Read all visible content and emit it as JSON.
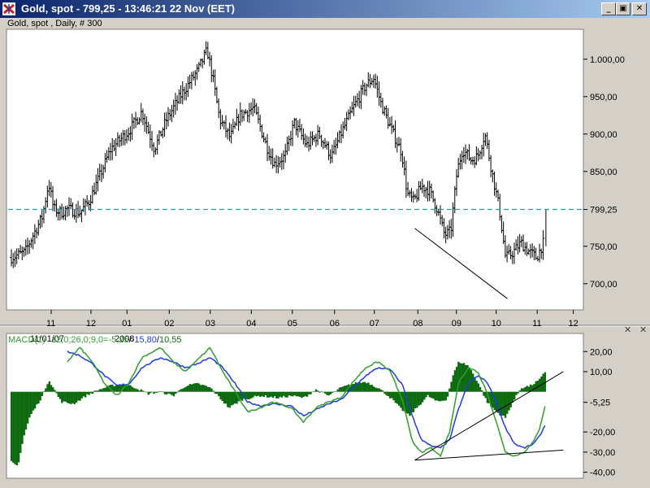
{
  "window": {
    "title": "Gold, spot - 799,25 - 13:46:21  22 Nov (EET)",
    "minimize_glyph": "_",
    "maximize_glyph": "▣",
    "close_glyph": "✕"
  },
  "colors": {
    "title_bar": "#0a246a",
    "price_bars": "#000000",
    "last_price_line": "#2f9fa0",
    "macd_line": "#2ea02e",
    "signal_line": "#1e3cdc",
    "histogram": "#0e6a0e"
  },
  "chart_data": [
    {
      "type": "ohlc",
      "title": "Gold, spot , Daily, # 300",
      "x_tick_labels": [
        "11",
        "12",
        "01",
        "02",
        "03",
        "04",
        "05",
        "06",
        "07",
        "08",
        "09",
        "10",
        "11",
        "12"
      ],
      "x_sub_labels": [
        "11/01/07",
        "2008"
      ],
      "y_tick_labels": [
        "1.000,00",
        "950,00",
        "900,00",
        "850,00",
        "799,25",
        "750,00",
        "700,00"
      ],
      "y_tick_values": [
        1000,
        950,
        900,
        850,
        799.25,
        750,
        700
      ],
      "ylim": [
        665,
        1040
      ],
      "last_price": 799.25,
      "last_price_label": "799,25",
      "grid": false,
      "price_path": [
        {
          "t": 0,
          "v": 735
        },
        {
          "t": 2.2,
          "v": 742
        },
        {
          "t": 3.2,
          "v": 760
        },
        {
          "t": 5,
          "v": 790
        },
        {
          "t": 6,
          "v": 835
        },
        {
          "t": 6.8,
          "v": 800
        },
        {
          "t": 8,
          "v": 795
        },
        {
          "t": 9,
          "v": 800
        },
        {
          "t": 11,
          "v": 795
        },
        {
          "t": 12.5,
          "v": 810
        },
        {
          "t": 14,
          "v": 840
        },
        {
          "t": 16,
          "v": 880
        },
        {
          "t": 19,
          "v": 905
        },
        {
          "t": 21,
          "v": 930
        },
        {
          "t": 23,
          "v": 880
        },
        {
          "t": 25,
          "v": 920
        },
        {
          "t": 27.5,
          "v": 955
        },
        {
          "t": 30,
          "v": 985
        },
        {
          "t": 31.5,
          "v": 1012
        },
        {
          "t": 32.4,
          "v": 975
        },
        {
          "t": 33.5,
          "v": 920
        },
        {
          "t": 35.2,
          "v": 895
        },
        {
          "t": 36.7,
          "v": 925
        },
        {
          "t": 39,
          "v": 935
        },
        {
          "t": 41,
          "v": 885
        },
        {
          "t": 42.3,
          "v": 860
        },
        {
          "t": 44,
          "v": 870
        },
        {
          "t": 45.5,
          "v": 915
        },
        {
          "t": 47.5,
          "v": 885
        },
        {
          "t": 49.5,
          "v": 900
        },
        {
          "t": 51.5,
          "v": 870
        },
        {
          "t": 53,
          "v": 900
        },
        {
          "t": 55,
          "v": 935
        },
        {
          "t": 57,
          "v": 965
        },
        {
          "t": 58.3,
          "v": 975
        },
        {
          "t": 59.5,
          "v": 940
        },
        {
          "t": 61.2,
          "v": 905
        },
        {
          "t": 62.8,
          "v": 875
        },
        {
          "t": 63.7,
          "v": 820
        },
        {
          "t": 64.7,
          "v": 810
        },
        {
          "t": 66,
          "v": 830
        },
        {
          "t": 67.2,
          "v": 825
        },
        {
          "t": 68.5,
          "v": 800
        },
        {
          "t": 69.7,
          "v": 765
        },
        {
          "t": 70.7,
          "v": 770
        },
        {
          "t": 71.7,
          "v": 850
        },
        {
          "t": 72.6,
          "v": 880
        },
        {
          "t": 74,
          "v": 865
        },
        {
          "t": 75,
          "v": 870
        },
        {
          "t": 76.2,
          "v": 900
        },
        {
          "t": 77.3,
          "v": 850
        },
        {
          "t": 78.5,
          "v": 800
        },
        {
          "t": 79.5,
          "v": 735
        },
        {
          "t": 80.5,
          "v": 740
        },
        {
          "t": 82,
          "v": 755
        },
        {
          "t": 83,
          "v": 745
        },
        {
          "t": 84.5,
          "v": 735
        },
        {
          "t": 85.6,
          "v": 755
        },
        {
          "t": 86,
          "v": 799.25
        }
      ],
      "trendlines": [
        {
          "from": {
            "t": 64.9,
            "v": 774
          },
          "to": {
            "t": 79.8,
            "v": 680
          }
        }
      ]
    },
    {
      "type": "macd",
      "title": "MACD(1) 12,0;26,0;9,0=-5,25/-15,80/10,55",
      "title_parts": {
        "name": "MACD(1)",
        "params": "12,0;26,0;9,0=",
        "macd_value": "-5,25",
        "signal_value": "-15,80",
        "hist_value": "10,55",
        "separator": "/"
      },
      "y_tick_labels": [
        "20,00",
        "10,00",
        "-5,25",
        "-20,00",
        "-30,00",
        "-40,00"
      ],
      "y_tick_values": [
        20,
        10,
        -5.25,
        -20,
        -30,
        -40
      ],
      "ylim": [
        -43,
        29
      ],
      "last_values": {
        "macd": -5.25,
        "signal": -15.8,
        "histogram": 10.55
      },
      "macd_path": [
        {
          "t": 9,
          "v": 15
        },
        {
          "t": 11,
          "v": 22
        },
        {
          "t": 13,
          "v": 15
        },
        {
          "t": 15,
          "v": 4
        },
        {
          "t": 17,
          "v": -2
        },
        {
          "t": 19,
          "v": 5
        },
        {
          "t": 21,
          "v": 17
        },
        {
          "t": 24,
          "v": 22
        },
        {
          "t": 26,
          "v": 15
        },
        {
          "t": 28,
          "v": 10
        },
        {
          "t": 30,
          "v": 16
        },
        {
          "t": 32,
          "v": 22
        },
        {
          "t": 34,
          "v": 10
        },
        {
          "t": 36,
          "v": 0
        },
        {
          "t": 38,
          "v": -10
        },
        {
          "t": 40,
          "v": -8
        },
        {
          "t": 42,
          "v": -5
        },
        {
          "t": 45,
          "v": -8
        },
        {
          "t": 47,
          "v": -15
        },
        {
          "t": 49,
          "v": -8
        },
        {
          "t": 51,
          "v": -5
        },
        {
          "t": 53,
          "v": -3
        },
        {
          "t": 55,
          "v": 5
        },
        {
          "t": 57,
          "v": 12
        },
        {
          "t": 59,
          "v": 15
        },
        {
          "t": 61,
          "v": 10
        },
        {
          "t": 63,
          "v": -5
        },
        {
          "t": 64.5,
          "v": -25
        },
        {
          "t": 66,
          "v": -30
        },
        {
          "t": 67.5,
          "v": -28
        },
        {
          "t": 69,
          "v": -32
        },
        {
          "t": 70.5,
          "v": -20
        },
        {
          "t": 72,
          "v": 5
        },
        {
          "t": 73.5,
          "v": 12
        },
        {
          "t": 75,
          "v": 10
        },
        {
          "t": 76.5,
          "v": 0
        },
        {
          "t": 78,
          "v": -15
        },
        {
          "t": 79.5,
          "v": -30
        },
        {
          "t": 81,
          "v": -32
        },
        {
          "t": 82.5,
          "v": -30
        },
        {
          "t": 84,
          "v": -25
        },
        {
          "t": 85,
          "v": -18
        },
        {
          "t": 86,
          "v": -5.25
        }
      ],
      "signal_path": [
        {
          "t": 9,
          "v": 20
        },
        {
          "t": 11,
          "v": 18
        },
        {
          "t": 13,
          "v": 14
        },
        {
          "t": 15,
          "v": 8
        },
        {
          "t": 17,
          "v": 3
        },
        {
          "t": 19,
          "v": 4
        },
        {
          "t": 21,
          "v": 12
        },
        {
          "t": 24,
          "v": 17
        },
        {
          "t": 26,
          "v": 15
        },
        {
          "t": 28,
          "v": 12
        },
        {
          "t": 30,
          "v": 14
        },
        {
          "t": 32,
          "v": 17
        },
        {
          "t": 34,
          "v": 12
        },
        {
          "t": 36,
          "v": 4
        },
        {
          "t": 38,
          "v": -5
        },
        {
          "t": 40,
          "v": -7
        },
        {
          "t": 42,
          "v": -6
        },
        {
          "t": 45,
          "v": -7
        },
        {
          "t": 47,
          "v": -12
        },
        {
          "t": 49,
          "v": -9
        },
        {
          "t": 51,
          "v": -6
        },
        {
          "t": 53,
          "v": -4
        },
        {
          "t": 55,
          "v": 2
        },
        {
          "t": 57,
          "v": 8
        },
        {
          "t": 59,
          "v": 12
        },
        {
          "t": 61,
          "v": 11
        },
        {
          "t": 63,
          "v": 3
        },
        {
          "t": 64.5,
          "v": -12
        },
        {
          "t": 66,
          "v": -24
        },
        {
          "t": 67.5,
          "v": -27
        },
        {
          "t": 69,
          "v": -28
        },
        {
          "t": 70.5,
          "v": -24
        },
        {
          "t": 72,
          "v": -8
        },
        {
          "t": 73.5,
          "v": 4
        },
        {
          "t": 75,
          "v": 8
        },
        {
          "t": 76.5,
          "v": 5
        },
        {
          "t": 78,
          "v": -5
        },
        {
          "t": 79.5,
          "v": -18
        },
        {
          "t": 81,
          "v": -26
        },
        {
          "t": 82.5,
          "v": -28
        },
        {
          "t": 84,
          "v": -26
        },
        {
          "t": 85,
          "v": -22
        },
        {
          "t": 86,
          "v": -15.8
        }
      ],
      "histogram_peaks": [
        {
          "t": 0,
          "v": -35
        },
        {
          "t": 1,
          "v": -37
        },
        {
          "t": 2,
          "v": -22
        },
        {
          "t": 3,
          "v": -12
        },
        {
          "t": 5,
          "v": -2
        },
        {
          "t": 6,
          "v": 6
        },
        {
          "t": 8,
          "v": -5
        },
        {
          "t": 10,
          "v": -6
        },
        {
          "t": 12,
          "v": -2
        },
        {
          "t": 14,
          "v": 1
        },
        {
          "t": 16,
          "v": 3
        },
        {
          "t": 18,
          "v": 4
        },
        {
          "t": 20,
          "v": 2
        },
        {
          "t": 22,
          "v": -1
        },
        {
          "t": 24,
          "v": 0
        },
        {
          "t": 26,
          "v": -2
        },
        {
          "t": 28,
          "v": 3
        },
        {
          "t": 30,
          "v": 4
        },
        {
          "t": 32,
          "v": 2
        },
        {
          "t": 33.5,
          "v": -3
        },
        {
          "t": 35,
          "v": -8
        },
        {
          "t": 37,
          "v": -4
        },
        {
          "t": 40,
          "v": -2
        },
        {
          "t": 43,
          "v": -3
        },
        {
          "t": 45,
          "v": -2
        },
        {
          "t": 47,
          "v": -3
        },
        {
          "t": 49,
          "v": 1
        },
        {
          "t": 51,
          "v": -2
        },
        {
          "t": 53,
          "v": 2
        },
        {
          "t": 55,
          "v": 4
        },
        {
          "t": 57,
          "v": 5
        },
        {
          "t": 59,
          "v": 2
        },
        {
          "t": 61,
          "v": -3
        },
        {
          "t": 62.5,
          "v": -8
        },
        {
          "t": 64,
          "v": -12
        },
        {
          "t": 65.5,
          "v": -7
        },
        {
          "t": 67,
          "v": -2
        },
        {
          "t": 68.5,
          "v": -5
        },
        {
          "t": 70,
          "v": -4
        },
        {
          "t": 71,
          "v": 8
        },
        {
          "t": 72,
          "v": 15
        },
        {
          "t": 73.5,
          "v": 13
        },
        {
          "t": 75,
          "v": 5
        },
        {
          "t": 76.5,
          "v": -5
        },
        {
          "t": 78,
          "v": -10
        },
        {
          "t": 79.5,
          "v": -13
        },
        {
          "t": 80.5,
          "v": -6
        },
        {
          "t": 82,
          "v": 2
        },
        {
          "t": 83.5,
          "v": 3
        },
        {
          "t": 85,
          "v": 6
        },
        {
          "t": 86,
          "v": 10.55
        }
      ],
      "trendlines": [
        {
          "from": {
            "t": 64.9,
            "v": -34
          },
          "to": {
            "t": 88.8,
            "v": 10
          }
        },
        {
          "from": {
            "t": 64.9,
            "v": -34
          },
          "to": {
            "t": 88.8,
            "v": -29
          }
        }
      ]
    }
  ]
}
